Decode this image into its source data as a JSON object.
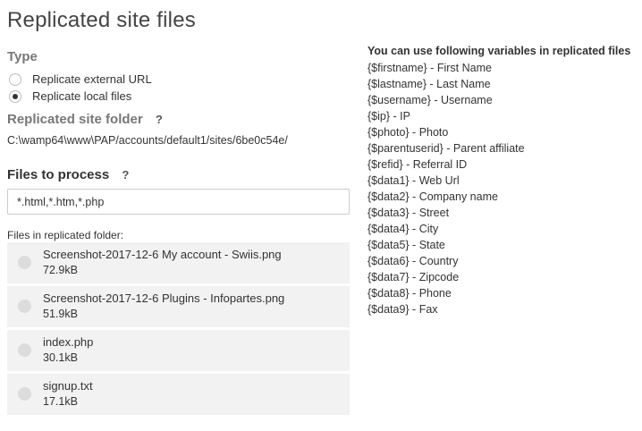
{
  "page": {
    "title": "Replicated site files"
  },
  "type_section": {
    "label": "Type",
    "options": [
      {
        "label": "Replicate external URL",
        "checked": false
      },
      {
        "label": "Replicate local files",
        "checked": true
      }
    ]
  },
  "site_folder": {
    "label": "Replicated site folder",
    "help": "?",
    "path": "C:\\wamp64\\www\\PAP/accounts/default1/sites/6be0c54e/"
  },
  "files_to_process": {
    "label": "Files to process",
    "help": "?",
    "value": "*.html,*.htm,*.php"
  },
  "folder_files": {
    "label": "Files in replicated folder:",
    "items": [
      {
        "name": "Screenshot-2017-12-6 My account - Swiis.png",
        "size": "72.9kB"
      },
      {
        "name": "Screenshot-2017-12-6 Plugins - Infopartes.png",
        "size": "51.9kB"
      },
      {
        "name": "index.php",
        "size": "30.1kB"
      },
      {
        "name": "signup.txt",
        "size": "17.1kB"
      }
    ]
  },
  "variables": {
    "heading": "You can use following variables in replicated files",
    "items": [
      "{$firstname} - First Name",
      "{$lastname} - Last Name",
      "{$username} - Username",
      "{$ip} - IP",
      "{$photo} - Photo",
      "{$parentuserid} - Parent affiliate",
      "{$refid} - Referral ID",
      "{$data1} - Web Url",
      "{$data2} - Company name",
      "{$data3} - Street",
      "{$data4} - City",
      "{$data5} - State",
      "{$data6} - Country",
      "{$data7} - Zipcode",
      "{$data8} - Phone",
      "{$data9} - Fax"
    ]
  }
}
